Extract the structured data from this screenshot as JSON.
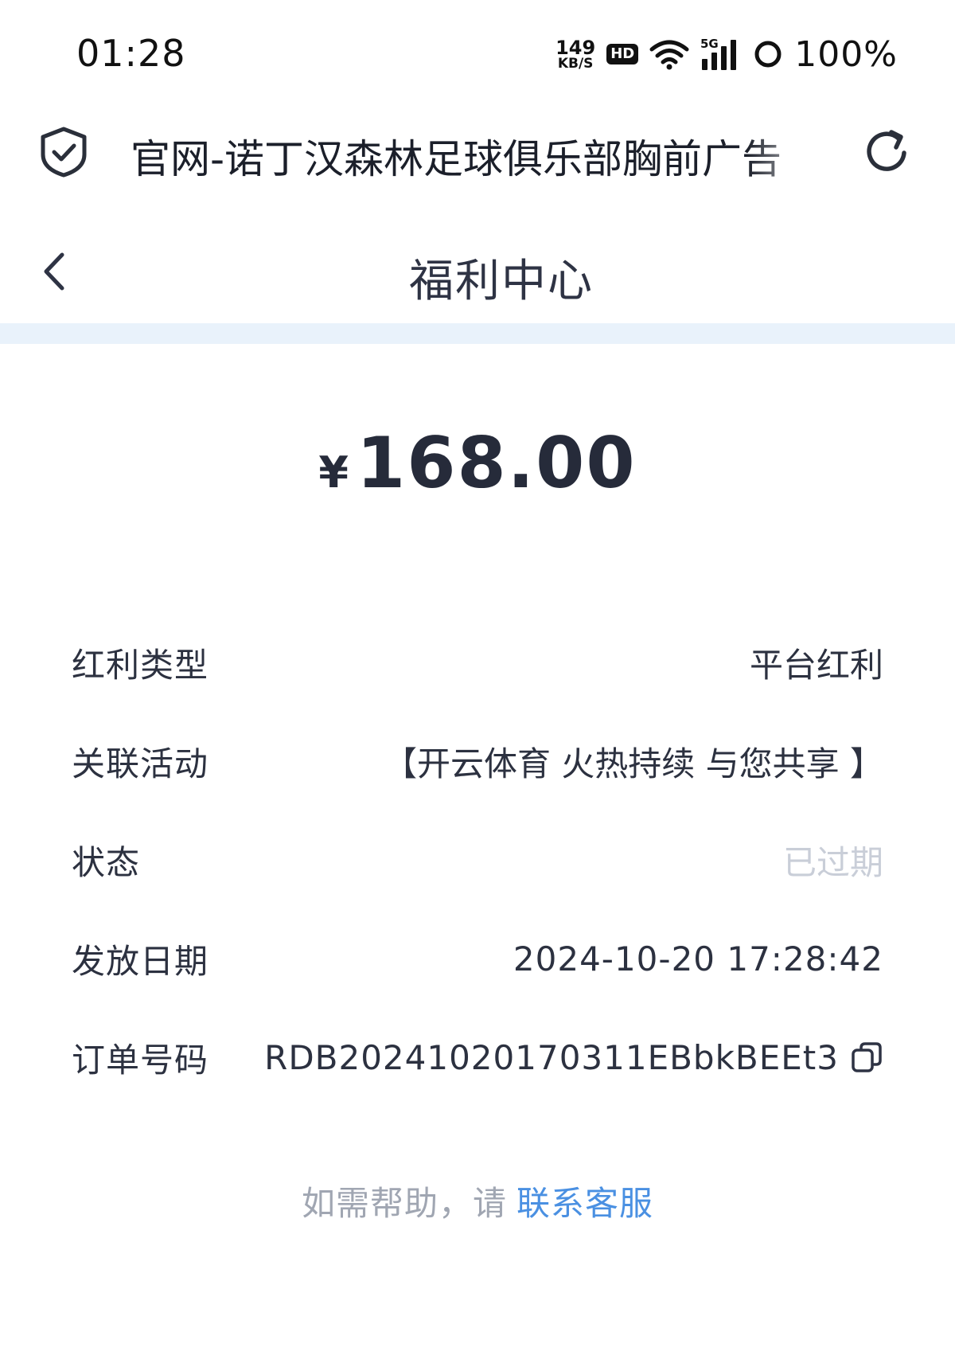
{
  "status_bar": {
    "time": "01:28",
    "net_speed_value": "149",
    "net_speed_unit": "KB/S",
    "hd_label": "HD",
    "signal_label": "5G",
    "battery": "100%"
  },
  "browser": {
    "title": "官网-诺丁汉森林足球俱乐部胸前广告"
  },
  "header": {
    "title": "福利中心"
  },
  "amount": {
    "currency": "¥",
    "value": "168.00"
  },
  "details": [
    {
      "label": "红利类型",
      "value": "平台红利"
    },
    {
      "label": "关联活动",
      "value": "【开云体育 火热持续 与您共享 】"
    },
    {
      "label": "状态",
      "value": "已过期"
    },
    {
      "label": "发放日期",
      "value": "2024-10-20 17:28:42"
    },
    {
      "label": "订单号码",
      "value": "RDB20241020170311EBbkBEEt3"
    }
  ],
  "help": {
    "prefix": "如需帮助，请",
    "link": "联系客服"
  },
  "colors": {
    "text": "#2c3140",
    "muted": "#c9ced8",
    "link": "#4a90e2",
    "band": "#e9f2fb"
  }
}
